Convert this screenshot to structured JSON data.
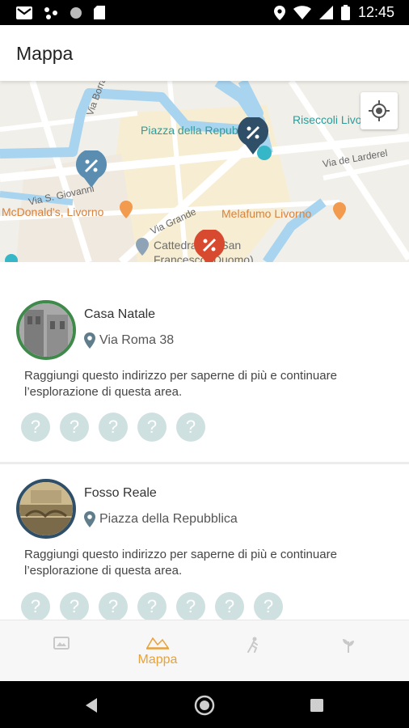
{
  "status_bar": {
    "time": "12:45",
    "left_icons": [
      "gmail-icon",
      "network-icon",
      "circle-icon",
      "sd-card-icon"
    ],
    "right_icons": [
      "location-icon",
      "wifi-icon",
      "signal-icon",
      "battery-icon"
    ]
  },
  "app_bar": {
    "title": "Mappa"
  },
  "map": {
    "labels": {
      "piazza": "Piazza della Repubblica",
      "riseccoli": "Riseccoli Livorno",
      "via_borra": "Via Borra",
      "via_de_larderel": "Via de Larderel",
      "via_s_giovanni": "Via S. Giovanni",
      "mcdonalds": "McDonald's, Livorno",
      "via_grande": "Via Grande",
      "melafumo": "Melafumo Livorno",
      "cattedrale": "Cattedrale di San Francesco (Duomo)"
    },
    "colors": {
      "water": "#a8d4ef",
      "road": "#ffffff",
      "block": "#f5ecd4",
      "marker_blue": "#5b8db0",
      "marker_dark": "#2f4f68",
      "marker_red": "#d84a2f"
    }
  },
  "places": [
    {
      "name": "Casa Natale",
      "address": "Via Roma 38",
      "description": "Raggiungi questo indirizzo per saperne di più e continuare l’esplorazione di questa area.",
      "ring_color": "#3f8a4a",
      "questions": [
        "?",
        "?",
        "?",
        "?",
        "?"
      ]
    },
    {
      "name": "Fosso Reale",
      "address": "Piazza della Repubblica",
      "description": "Raggiungi questo indirizzo per saperne di più e continuare l’esplorazione di questa area.",
      "ring_color": "#2f4f68",
      "questions": [
        "?",
        "?",
        "?",
        "?",
        "?",
        "?",
        "?"
      ]
    }
  ],
  "bottom_nav": {
    "items": [
      {
        "icon": "gallery-icon",
        "label": ""
      },
      {
        "icon": "map-icon",
        "label": "Mappa",
        "active": true
      },
      {
        "icon": "explorer-icon",
        "label": ""
      },
      {
        "icon": "plant-icon",
        "label": ""
      }
    ],
    "active_color": "#e8a23a"
  },
  "system_nav": [
    "back-icon",
    "home-icon",
    "recents-icon"
  ]
}
